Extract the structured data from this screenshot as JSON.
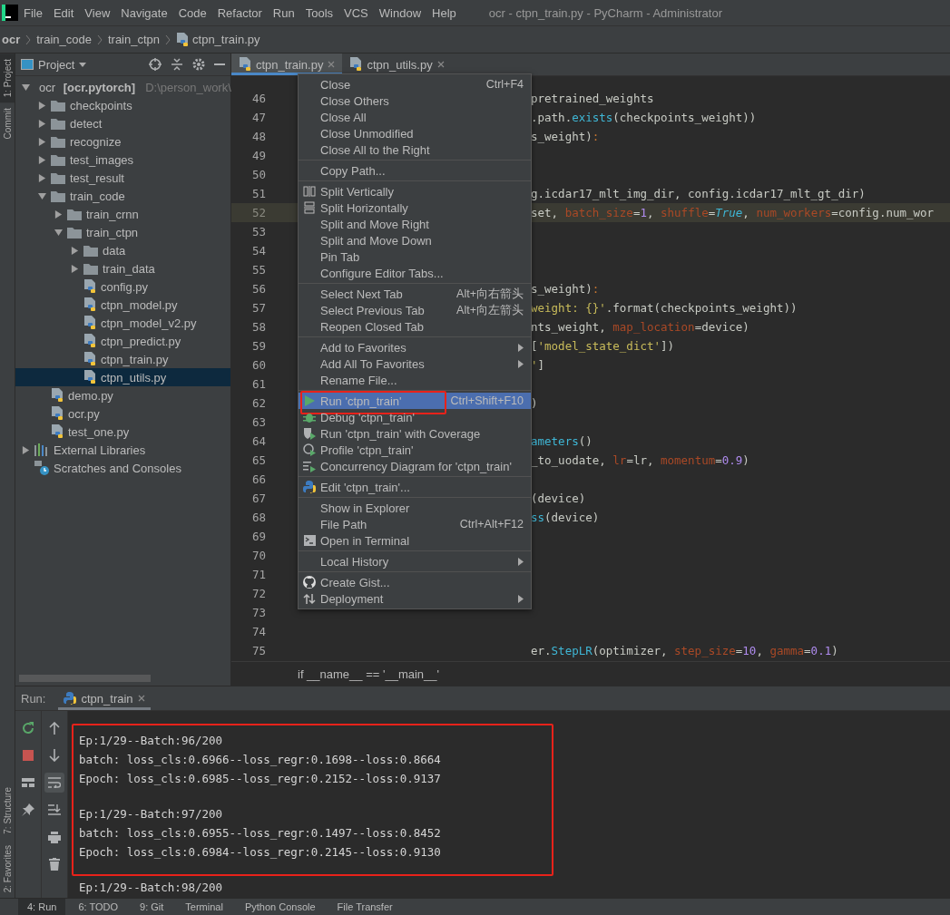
{
  "window": {
    "title": "ocr - ctpn_train.py - PyCharm - Administrator"
  },
  "menu_bar": [
    "File",
    "Edit",
    "View",
    "Navigate",
    "Code",
    "Refactor",
    "Run",
    "Tools",
    "VCS",
    "Window",
    "Help"
  ],
  "breadcrumbs": [
    {
      "label": "ocr",
      "kind": "project"
    },
    {
      "label": "train_code",
      "kind": "folder"
    },
    {
      "label": "train_ctpn",
      "kind": "folder"
    },
    {
      "label": "ctpn_train.py",
      "kind": "file"
    }
  ],
  "side_strip": {
    "top": [
      {
        "label": "1: Project",
        "selected": true
      },
      {
        "label": "Commit",
        "selected": false
      }
    ],
    "bottom": [
      {
        "label": "7: Structure",
        "selected": false
      },
      {
        "label": "2: Favorites",
        "selected": false
      }
    ]
  },
  "project_panel": {
    "title": "Project",
    "tree": [
      {
        "kind": "root",
        "label": "ocr",
        "module": "[ocr.pytorch]",
        "path": "D:\\person_work\\",
        "expanded": true,
        "selected": false,
        "children": [
          {
            "kind": "folder",
            "label": "checkpoints",
            "expanded": false,
            "selected": false
          },
          {
            "kind": "folder",
            "label": "detect",
            "expanded": false,
            "selected": false
          },
          {
            "kind": "folder",
            "label": "recognize",
            "expanded": false,
            "selected": false
          },
          {
            "kind": "folder",
            "label": "test_images",
            "expanded": false,
            "selected": false
          },
          {
            "kind": "folder",
            "label": "test_result",
            "expanded": false,
            "selected": false
          },
          {
            "kind": "folder",
            "label": "train_code",
            "expanded": true,
            "selected": false,
            "children": [
              {
                "kind": "folder",
                "label": "train_crnn",
                "expanded": false,
                "selected": false
              },
              {
                "kind": "folder",
                "label": "train_ctpn",
                "expanded": true,
                "selected": false,
                "children": [
                  {
                    "kind": "folder",
                    "label": "data",
                    "expanded": false,
                    "selected": false
                  },
                  {
                    "kind": "folder",
                    "label": "train_data",
                    "expanded": false,
                    "selected": false
                  },
                  {
                    "kind": "file",
                    "label": "config.py",
                    "selected": false
                  },
                  {
                    "kind": "file",
                    "label": "ctpn_model.py",
                    "selected": false
                  },
                  {
                    "kind": "file",
                    "label": "ctpn_model_v2.py",
                    "selected": false
                  },
                  {
                    "kind": "file",
                    "label": "ctpn_predict.py",
                    "selected": false
                  },
                  {
                    "kind": "file",
                    "label": "ctpn_train.py",
                    "selected": false
                  },
                  {
                    "kind": "file",
                    "label": "ctpn_utils.py",
                    "selected": true
                  }
                ]
              }
            ]
          },
          {
            "kind": "file",
            "label": "demo.py",
            "selected": false
          },
          {
            "kind": "file",
            "label": "ocr.py",
            "selected": false
          },
          {
            "kind": "file",
            "label": "test_one.py",
            "selected": false
          }
        ]
      },
      {
        "kind": "library",
        "label": "External Libraries",
        "expanded": false,
        "selected": false
      },
      {
        "kind": "scratches",
        "label": "Scratches and Consoles",
        "selected": false
      }
    ]
  },
  "editor": {
    "tabs": [
      {
        "label": "ctpn_train.py",
        "selected": true
      },
      {
        "label": "ctpn_utils.py",
        "selected": false
      }
    ],
    "lines": [
      {
        "number": "46",
        "current": false,
        "code": [
          {
            "text": "pretrained_weights",
            "kind": "plain"
          }
        ]
      },
      {
        "number": "47",
        "current": false,
        "code": [
          {
            "text": ".path.",
            "kind": "plain"
          },
          {
            "text": "exists",
            "kind": "fn"
          },
          {
            "text": "(checkpoints_weight))",
            "kind": "plain"
          }
        ]
      },
      {
        "number": "48",
        "current": false,
        "code": [
          {
            "text": "s_weight)",
            "kind": "plain"
          },
          {
            "text": ":",
            "kind": "keyword"
          }
        ]
      },
      {
        "number": "49",
        "current": false
      },
      {
        "number": "50",
        "current": false
      },
      {
        "number": "51",
        "current": false,
        "code": [
          {
            "text": "g.icdar17_mlt_img_dir, config.icdar17_mlt_gt_dir)",
            "kind": "plain"
          }
        ]
      },
      {
        "number": "52",
        "current": true,
        "code": [
          {
            "text": "set, ",
            "kind": "plain"
          },
          {
            "text": "batch_size",
            "kind": "param"
          },
          {
            "text": "=",
            "kind": "plain"
          },
          {
            "text": "1",
            "kind": "number"
          },
          {
            "text": ", ",
            "kind": "plain"
          },
          {
            "text": "shuffle",
            "kind": "param"
          },
          {
            "text": "=",
            "kind": "plain"
          },
          {
            "text": "True",
            "kind": "italic"
          },
          {
            "text": ", ",
            "kind": "plain"
          },
          {
            "text": "num_workers",
            "kind": "param"
          },
          {
            "text": "=config.num_wor",
            "kind": "plain"
          }
        ]
      },
      {
        "number": "53",
        "current": false
      },
      {
        "number": "54",
        "current": false
      },
      {
        "number": "55",
        "current": false
      },
      {
        "number": "56",
        "current": false,
        "code": [
          {
            "text": "s_weight)",
            "kind": "plain"
          },
          {
            "text": ":",
            "kind": "keyword"
          }
        ]
      },
      {
        "number": "57",
        "current": false,
        "code": [
          {
            "text": "weight: {}'",
            "kind": "string"
          },
          {
            "text": ".format(checkpoints_weight))",
            "kind": "plain"
          }
        ]
      },
      {
        "number": "58",
        "current": false,
        "code": [
          {
            "text": "nts_weight, ",
            "kind": "plain"
          },
          {
            "text": "map_location",
            "kind": "param"
          },
          {
            "text": "=device)",
            "kind": "plain"
          }
        ]
      },
      {
        "number": "59",
        "current": false,
        "code": [
          {
            "text": "[",
            "kind": "plain"
          },
          {
            "text": "'model_state_dict'",
            "kind": "string"
          },
          {
            "text": "])",
            "kind": "plain"
          }
        ]
      },
      {
        "number": "60",
        "current": false,
        "code": [
          {
            "text": "'",
            "kind": "string"
          },
          {
            "text": "]",
            "kind": "plain"
          }
        ]
      },
      {
        "number": "61",
        "current": false
      },
      {
        "number": "62",
        "current": false,
        "code": [
          {
            "text": ")",
            "kind": "plain"
          }
        ]
      },
      {
        "number": "63",
        "current": false
      },
      {
        "number": "64",
        "current": false,
        "code": [
          {
            "text": "ameters",
            "kind": "fn"
          },
          {
            "text": "()",
            "kind": "plain"
          }
        ]
      },
      {
        "number": "65",
        "current": false,
        "code": [
          {
            "text": "_to_uodate, ",
            "kind": "plain"
          },
          {
            "text": "lr",
            "kind": "param"
          },
          {
            "text": "=lr, ",
            "kind": "plain"
          },
          {
            "text": "momentum",
            "kind": "param"
          },
          {
            "text": "=",
            "kind": "plain"
          },
          {
            "text": "0.9",
            "kind": "number"
          },
          {
            "text": ")",
            "kind": "plain"
          }
        ]
      },
      {
        "number": "66",
        "current": false
      },
      {
        "number": "67",
        "current": false,
        "code": [
          {
            "text": "(device)",
            "kind": "plain"
          }
        ]
      },
      {
        "number": "68",
        "current": false,
        "code": [
          {
            "text": "ss",
            "kind": "fn"
          },
          {
            "text": "(device)",
            "kind": "plain"
          }
        ]
      },
      {
        "number": "69",
        "current": false
      },
      {
        "number": "70",
        "current": false
      },
      {
        "number": "71",
        "current": false
      },
      {
        "number": "72",
        "current": false
      },
      {
        "number": "73",
        "current": false
      },
      {
        "number": "74",
        "current": false
      },
      {
        "number": "75",
        "current": false,
        "code": [
          {
            "text": "er.",
            "kind": "plain"
          },
          {
            "text": "StepLR",
            "kind": "fn"
          },
          {
            "text": "(optimizer, ",
            "kind": "plain"
          },
          {
            "text": "step_size",
            "kind": "param"
          },
          {
            "text": "=",
            "kind": "plain"
          },
          {
            "text": "10",
            "kind": "number"
          },
          {
            "text": ", ",
            "kind": "plain"
          },
          {
            "text": "gamma",
            "kind": "param"
          },
          {
            "text": "=",
            "kind": "plain"
          },
          {
            "text": "0.1",
            "kind": "number"
          },
          {
            "text": ")",
            "kind": "plain"
          }
        ]
      }
    ],
    "footer": "if __name__ == '__main__'"
  },
  "context_menu": {
    "groups": [
      [
        {
          "label": "Close",
          "shortcut": "Ctrl+F4",
          "submenu": false,
          "selected": false
        },
        {
          "label": "Close Others",
          "submenu": false,
          "selected": false
        },
        {
          "label": "Close All",
          "submenu": false,
          "selected": false
        },
        {
          "label": "Close Unmodified",
          "submenu": false,
          "selected": false
        },
        {
          "label": "Close All to the Right",
          "submenu": false,
          "selected": false
        }
      ],
      [
        {
          "label": "Copy Path...",
          "submenu": false,
          "selected": false
        }
      ],
      [
        {
          "label": "Split Vertically",
          "submenu": false,
          "selected": false
        },
        {
          "label": "Split Horizontally",
          "submenu": false,
          "selected": false
        },
        {
          "label": "Split and Move Right",
          "submenu": false,
          "selected": false
        },
        {
          "label": "Split and Move Down",
          "submenu": false,
          "selected": false
        },
        {
          "label": "Pin Tab",
          "submenu": false,
          "selected": false
        },
        {
          "label": "Configure Editor Tabs...",
          "submenu": false,
          "selected": false
        }
      ],
      [
        {
          "label": "Select Next Tab",
          "shortcut": "Alt+向右箭头",
          "submenu": false,
          "selected": false
        },
        {
          "label": "Select Previous Tab",
          "shortcut": "Alt+向左箭头",
          "submenu": false,
          "selected": false
        },
        {
          "label": "Reopen Closed Tab",
          "submenu": false,
          "selected": false
        }
      ],
      [
        {
          "label": "Add to Favorites",
          "submenu": true,
          "selected": false
        },
        {
          "label": "Add All To Favorites",
          "submenu": true,
          "selected": false
        },
        {
          "label": "Rename File...",
          "submenu": false,
          "selected": false
        }
      ],
      [
        {
          "label": "Run 'ctpn_train'",
          "shortcut": "Ctrl+Shift+F10",
          "submenu": false,
          "selected": true
        },
        {
          "label": "Debug 'ctpn_train'",
          "submenu": false,
          "selected": false
        },
        {
          "label": "Run 'ctpn_train' with Coverage",
          "submenu": false,
          "selected": false
        },
        {
          "label": "Profile 'ctpn_train'",
          "submenu": false,
          "selected": false
        },
        {
          "label": "Concurrency Diagram for 'ctpn_train'",
          "submenu": false,
          "selected": false
        }
      ],
      [
        {
          "label": "Edit 'ctpn_train'...",
          "submenu": false,
          "selected": false
        }
      ],
      [
        {
          "label": "Show in Explorer",
          "submenu": false,
          "selected": false
        },
        {
          "label": "File Path",
          "shortcut": "Ctrl+Alt+F12",
          "submenu": false,
          "selected": false
        },
        {
          "label": "Open in Terminal",
          "submenu": false,
          "selected": false
        }
      ],
      [
        {
          "label": "Local History",
          "submenu": true,
          "selected": false
        }
      ],
      [
        {
          "label": "Create Gist...",
          "submenu": false,
          "selected": false
        },
        {
          "label": "Deployment",
          "submenu": true,
          "selected": false
        }
      ]
    ]
  },
  "run_panel": {
    "label": "Run:",
    "tabs": [
      {
        "label": "ctpn_train",
        "selected": true
      }
    ],
    "console": [
      [
        "Ep:1/29--Batch:96/200",
        "batch: loss_cls:0.6966--loss_regr:0.1698--loss:0.8664",
        "Epoch: loss_cls:0.6985--loss_regr:0.2152--loss:0.9137"
      ],
      [
        "Ep:1/29--Batch:97/200",
        "batch: loss_cls:0.6955--loss_regr:0.1497--loss:0.8452",
        "Epoch: loss_cls:0.6984--loss_regr:0.2145--loss:0.9130"
      ],
      [
        "Ep:1/29--Batch:98/200"
      ]
    ]
  },
  "tool_window_bar": [
    {
      "label": "4: Run",
      "selected": true
    },
    {
      "label": "6: TODO",
      "selected": false
    },
    {
      "label": "9: Git",
      "selected": false
    },
    {
      "label": "Terminal",
      "selected": false
    },
    {
      "label": "Python Console",
      "selected": false
    },
    {
      "label": "File Transfer",
      "selected": false
    }
  ]
}
